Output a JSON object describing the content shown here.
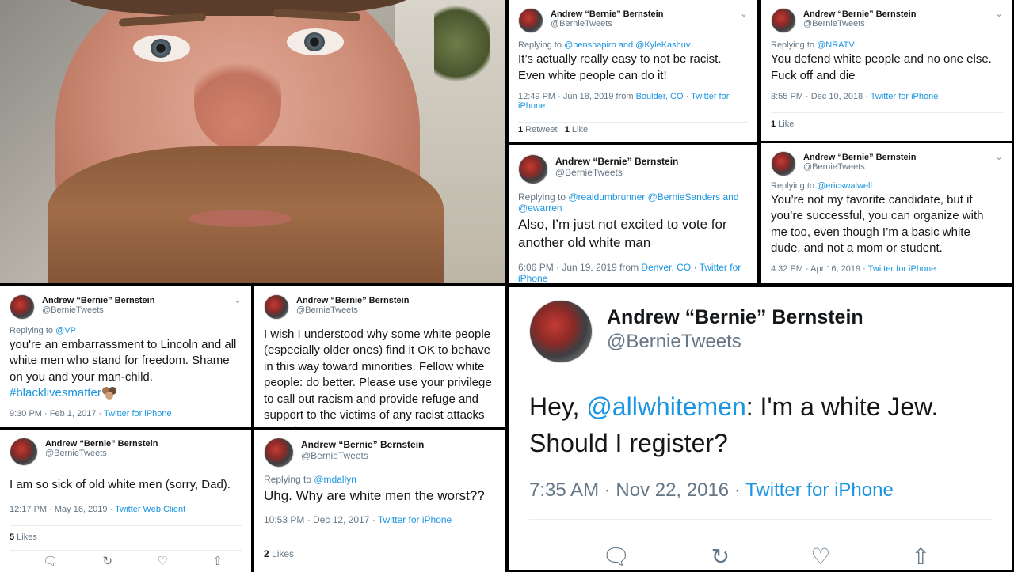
{
  "author": {
    "name": "Andrew “Bernie” Bernstein",
    "handle": "@BernieTweets"
  },
  "tweets": {
    "t1": {
      "reply_prefix": "Replying to ",
      "reply_to": "@benshapiro and @KyleKashuv",
      "text": "It’s actually really easy to not be racist. Even white people can do it!",
      "meta": "12:49 PM · Jun 18, 2019 from ",
      "place": "Boulder, CO",
      "sep": " · ",
      "client": "Twitter for iPhone",
      "stat1_num": "1",
      "stat1_label": " Retweet",
      "stat2_num": "1",
      "stat2_label": " Like"
    },
    "t2": {
      "reply_prefix": "Replying to ",
      "reply_to": "@NRATV",
      "text": "You defend white people and no one else. Fuck off and die",
      "meta": "3:55 PM · Dec 10, 2018 · ",
      "client": "Twitter for iPhone",
      "stat1_num": "1",
      "stat1_label": " Like"
    },
    "t3": {
      "reply_prefix": "Replying to ",
      "reply_to": "@realdumbrunner @BernieSanders and @ewarren",
      "text": "Also, I’m just not excited to vote for another old white man",
      "meta": "6:06 PM · Jun 19, 2019 from ",
      "place": "Denver, CO",
      "sep": " · ",
      "client": "Twitter for iPhone"
    },
    "t4": {
      "reply_prefix": "Replying to ",
      "reply_to": "@ericswalwell",
      "text": "You’re not my favorite candidate, but if you’re successful, you can organize with me too, even though I’m a basic white dude, and not a mom or student.",
      "meta": "4:32 PM · Apr 16, 2019 · ",
      "client": "Twitter for iPhone"
    },
    "t5": {
      "reply_prefix": "Replying to ",
      "reply_to": "@VP",
      "text": "you're an embarrassment to Lincoln and all white men who stand for freedom. Shame on you and your man-child.",
      "hashtag": "#blacklivesmatter",
      "meta": "9:30 PM · Feb 1, 2017 · ",
      "client": "Twitter for iPhone"
    },
    "t6": {
      "text": "I wish I understood why some white people (especially older ones) find it OK to behave in this way toward minorities. Fellow white people: do better. Please use your privilege to call out racism and provide refuge and support to the victims of any racist attacks you witness."
    },
    "t7": {
      "text": "I am so sick of old white men (sorry, Dad).",
      "meta": "12:17 PM · May 16, 2019 · ",
      "client": "Twitter Web Client",
      "stat1_num": "5",
      "stat1_label": " Likes"
    },
    "t8": {
      "reply_prefix": "Replying to ",
      "reply_to": "@mdallyn",
      "text": "Uhg. Why are white men the worst??",
      "meta": "10:53 PM · Dec 12, 2017 · ",
      "client": "Twitter for iPhone",
      "stat1_num": "2",
      "stat1_label": " Likes"
    },
    "big": {
      "text_before": "Hey, ",
      "mention": "@allwhitemen",
      "text_after": ": I'm a white Jew. Should I register?",
      "meta": "7:35 AM · Nov 22, 2016 · ",
      "client": "Twitter for iPhone"
    }
  },
  "icons": {
    "chevron": "⌄",
    "reply": "🗨",
    "retweet": "↻",
    "like": "♡",
    "share": "⇧"
  },
  "colors": {
    "link": "#1b95e0",
    "muted": "#657786",
    "text": "#14171a"
  }
}
